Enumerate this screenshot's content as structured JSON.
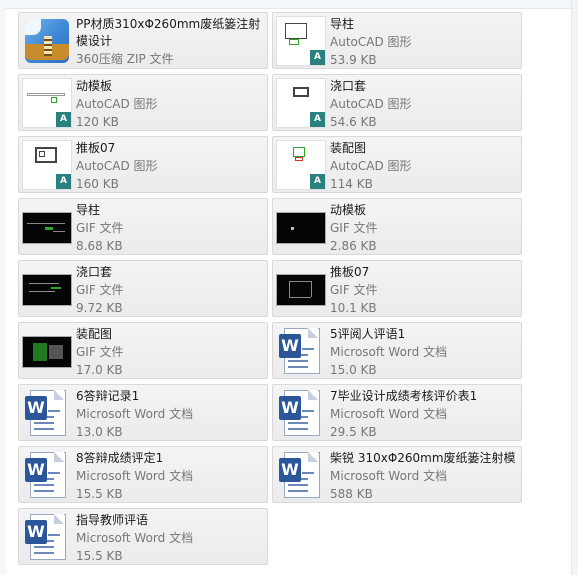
{
  "files": [
    {
      "name": "PP材质310xΦ260mm废纸篓注射模设计",
      "type": "360压缩 ZIP 文件",
      "size": "",
      "icon": "zip-archive-icon",
      "wrap": true
    },
    {
      "name": "导柱",
      "type": "AutoCAD 图形",
      "size": "53.9 KB",
      "icon": "autocad-drawing-icon"
    },
    {
      "name": "动模板",
      "type": "AutoCAD 图形",
      "size": "120 KB",
      "icon": "autocad-drawing-icon"
    },
    {
      "name": "浇口套",
      "type": "AutoCAD 图形",
      "size": "54.6 KB",
      "icon": "autocad-drawing-icon"
    },
    {
      "name": "推板07",
      "type": "AutoCAD 图形",
      "size": "160 KB",
      "icon": "autocad-drawing-icon"
    },
    {
      "name": "装配图",
      "type": "AutoCAD 图形",
      "size": "114 KB",
      "icon": "autocad-drawing-icon"
    },
    {
      "name": "导柱",
      "type": "GIF 文件",
      "size": "8.68 KB",
      "icon": "gif-image-thumbnail"
    },
    {
      "name": "动模板",
      "type": "GIF 文件",
      "size": "2.86 KB",
      "icon": "gif-image-thumbnail"
    },
    {
      "name": "浇口套",
      "type": "GIF 文件",
      "size": "9.72 KB",
      "icon": "gif-image-thumbnail"
    },
    {
      "name": "推板07",
      "type": "GIF 文件",
      "size": "10.1 KB",
      "icon": "gif-image-thumbnail"
    },
    {
      "name": "装配图",
      "type": "GIF 文件",
      "size": "17.0 KB",
      "icon": "gif-image-thumbnail"
    },
    {
      "name": "5评阅人评语1",
      "type": "Microsoft Word 文档",
      "size": "15.0 KB",
      "icon": "word-document-icon"
    },
    {
      "name": "6答辩记录1",
      "type": "Microsoft Word 文档",
      "size": "13.0 KB",
      "icon": "word-document-icon"
    },
    {
      "name": "7毕业设计成绩考核评价表1",
      "type": "Microsoft Word 文档",
      "size": "29.5 KB",
      "icon": "word-document-icon"
    },
    {
      "name": "8答辩成绩评定1",
      "type": "Microsoft Word 文档",
      "size": "15.5 KB",
      "icon": "word-document-icon"
    },
    {
      "name": "柴锐 310xΦ260mm废纸篓注射模",
      "type": "Microsoft Word 文档",
      "size": "588 KB",
      "icon": "word-document-icon"
    },
    {
      "name": "指导教师评语",
      "type": "Microsoft Word 文档",
      "size": "15.5 KB",
      "icon": "word-document-icon"
    }
  ],
  "labels": {
    "cad_badge": "A",
    "word_badge": "W"
  }
}
